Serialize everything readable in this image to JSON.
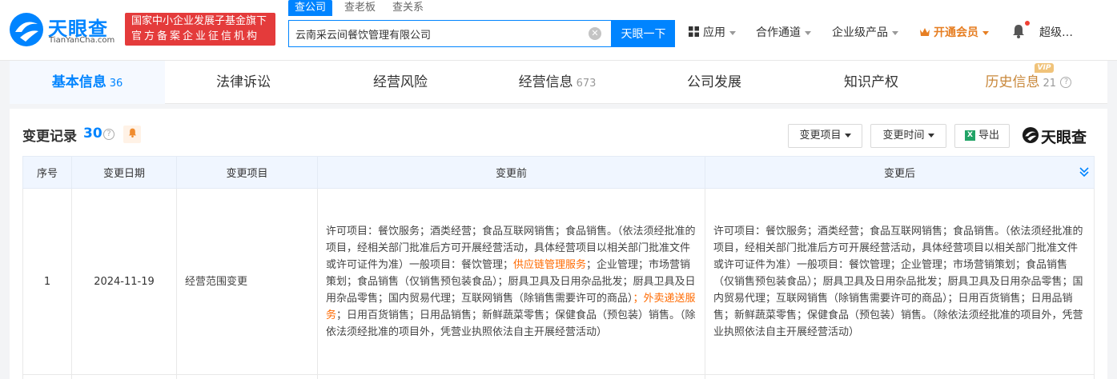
{
  "header": {
    "logo_text": "天眼查",
    "logo_sub": "TianYanCha.com",
    "badge_line1": "国家中小企业发展子基金旗下",
    "badge_line2": "官方备案企业征信机构",
    "search_tabs": [
      "查公司",
      "查老板",
      "查关系"
    ],
    "search_value": "云南采云间餐饮管理有限公司",
    "search_button": "天眼一下",
    "nav": {
      "apps": "应用",
      "channels": "合作通道",
      "enterprise": "企业级产品",
      "vip": "开通会员",
      "user": "超级…"
    }
  },
  "tabs": [
    {
      "label": "基本信息",
      "count": "36"
    },
    {
      "label": "法律诉讼",
      "count": ""
    },
    {
      "label": "经营风险",
      "count": ""
    },
    {
      "label": "经营信息",
      "count": "673"
    },
    {
      "label": "公司发展",
      "count": ""
    },
    {
      "label": "知识产权",
      "count": ""
    },
    {
      "label": "历史信息",
      "count": "21"
    }
  ],
  "vip_tag": "VIP",
  "section": {
    "title": "变更记录",
    "count": "30",
    "filter_item": "变更项目",
    "filter_time": "变更时间",
    "export": "导出",
    "brand": "天眼查"
  },
  "table": {
    "headers": [
      "序号",
      "变更日期",
      "变更项目",
      "变更前",
      "变更后"
    ],
    "rows": [
      {
        "index": "1",
        "date": "2024-11-19",
        "item": "经营范围变更",
        "before_parts": [
          "许可项目：餐饮服务；酒类经营；食品互联网销售；食品销售。（依法须经批准的项目，经相关部门批准后方可开展经营活动，具体经营项目以相关部门批准文件或许可证件为准）一般项目：餐饮管理；",
          "供应链管理服务",
          "；企业管理；市场营销策划；食品销售（仅销售预包装食品）；厨具卫具及日用杂品批发；厨具卫具及日用杂品零售；国内贸易代理；互联网销售（除销售需要许可的商品）",
          "；外卖递送服务",
          "；日用百货销售；日用品销售；新鲜蔬菜零售；保健食品（预包装）销售。（除依法须经批准的项目外，凭营业执照依法自主开展经营活动）"
        ],
        "after": "许可项目：餐饮服务；酒类经营；食品互联网销售；食品销售。（依法须经批准的项目，经相关部门批准后方可开展经营活动，具体经营项目以相关部门批准文件或许可证件为准）一般项目：餐饮管理；企业管理；市场营销策划；食品销售（仅销售预包装食品）；厨具卫具及日用杂品批发；厨具卫具及日用杂品零售；国内贸易代理；互联网销售（除销售需要许可的商品）；日用百货销售；日用品销售；新鲜蔬菜零售；保健食品（预包装）销售。（除依法须经批准的项目外，凭营业执照依法自主开展经营活动）"
      }
    ]
  },
  "colors": {
    "brand_blue": "#0084ff",
    "badge_red": "#e43b3b",
    "highlight_orange": "#ff6a00",
    "history_gold": "#c8873a"
  }
}
